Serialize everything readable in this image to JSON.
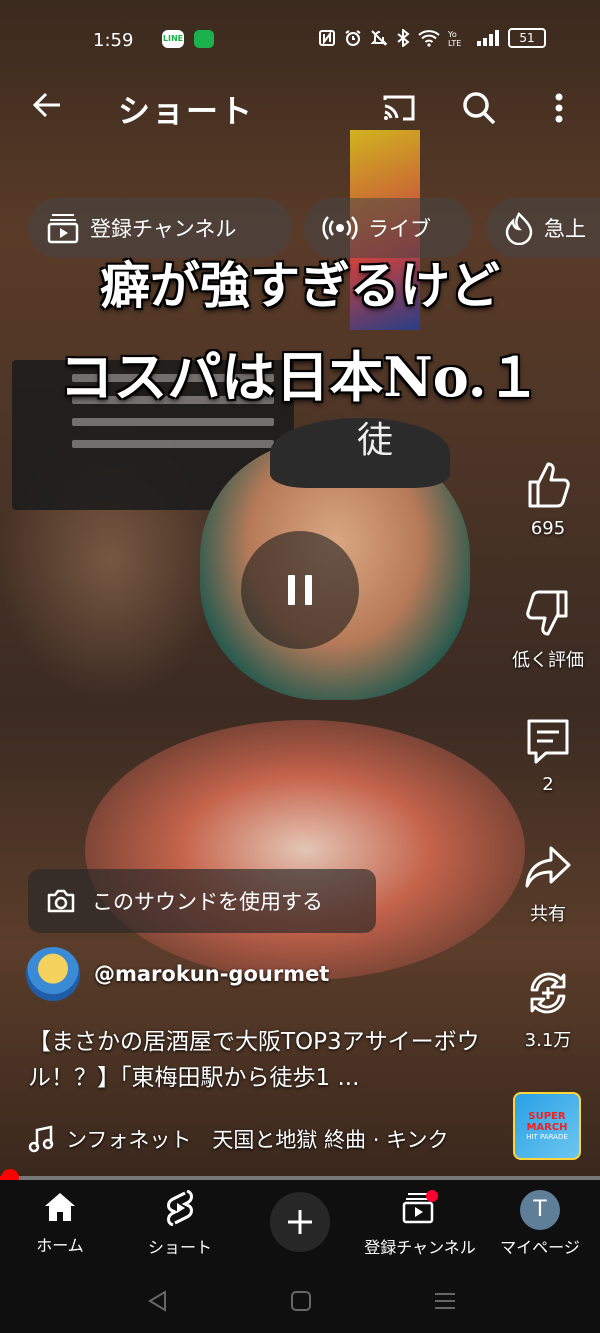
{
  "status_bar": {
    "time": "1:59",
    "line_icon": "LINE",
    "battery": "51"
  },
  "header": {
    "title": "ショート"
  },
  "chips": [
    {
      "label": "登録チャンネル",
      "icon": "subscriptions-icon"
    },
    {
      "label": "ライブ",
      "icon": "live-icon"
    },
    {
      "label": "急上",
      "icon": "trending-icon"
    }
  ],
  "video_overlay": {
    "line1": "癖が強すぎるけど",
    "line2": "コスパは日本No.１",
    "cap_text": "徒"
  },
  "actions": {
    "like_count": "695",
    "dislike_label": "低く評価",
    "comments_count": "2",
    "share_label": "共有",
    "remix_count": "3.1万"
  },
  "sound_chip": {
    "label": "このサウンドを使用する"
  },
  "channel": {
    "handle": "@marokun-gourmet"
  },
  "description": "【まさかの居酒屋で大阪TOP3アサイーボウル！？】「東梅田駅から徒歩1 ...",
  "music": {
    "track": "ンフォネット　天国と地獄 終曲 · キンク"
  },
  "album": {
    "line1": "SUPER",
    "line2": "MARCH",
    "line3": "HIT PARADE"
  },
  "progress": {
    "fraction": 0.01
  },
  "nav": {
    "home": "ホーム",
    "shorts": "ショート",
    "subscriptions": "登録チャンネル",
    "mypage": "マイページ",
    "avatar_letter": "T"
  },
  "colors": {
    "accent": "#ff0000",
    "background": "#0f0f0f"
  }
}
